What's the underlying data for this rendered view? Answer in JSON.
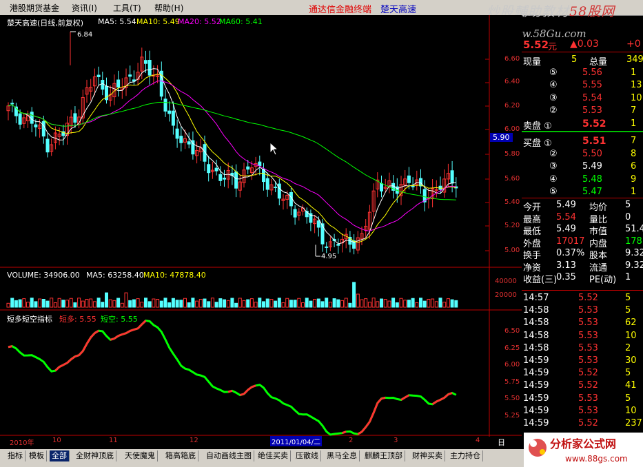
{
  "menu": {
    "items": [
      "港股期货基金",
      "资讯(I)",
      "工具(T)",
      "帮助(H)"
    ],
    "title_a": "通达信金融终端",
    "title_b": "楚天高速"
  },
  "watermarks": {
    "top_text_a": "炒股輔助教材",
    "top_text_b": "58股网",
    "top_url": "www.58Gu.com",
    "bottom_text": "分析家公式网",
    "bottom_url": "www.88gs.com"
  },
  "main_chart": {
    "header": "楚天高速(日线,前复权)",
    "ma5": "MA5: 5.54",
    "ma10": "MA10: 5.49",
    "ma20": "MA20: 5.52",
    "ma60": "MA60: 5.41",
    "high_label": "6.84",
    "low_label": "4.95",
    "y_ticks": [
      "6.60",
      "6.40",
      "6.20",
      "6.00",
      "5.80",
      "5.60",
      "5.40",
      "5.20",
      "5.00"
    ],
    "cursor_price": "5.90"
  },
  "volume_chart": {
    "header": "VOLUME: 34906.00",
    "ma5": "MA5: 63258.40",
    "ma10": "MA10: 47878.40",
    "y_ticks": [
      "40000",
      "20000"
    ]
  },
  "indicator": {
    "name": "短多短空指标",
    "long": "短多: 5.55",
    "short": "短空: 5.55",
    "y_ticks": [
      "6.50",
      "6.25",
      "6.00",
      "5.75",
      "5.50",
      "5.25"
    ]
  },
  "x_axis": {
    "labels": [
      "2010年",
      "10",
      "11",
      "12",
      "2011/01/04/二",
      "2",
      "3",
      "4"
    ],
    "day_label": "日"
  },
  "quote": {
    "price": "5.52",
    "unit": "元",
    "change": "▲0.03",
    "change_pct": "+0",
    "rows": [
      {
        "a": "现量",
        "b": "5",
        "c": "总量",
        "d": "349"
      },
      {
        "a": "⑤",
        "b": "5.56",
        "d": "1"
      },
      {
        "a": "④",
        "b": "5.55",
        "d": "13"
      },
      {
        "a": "③",
        "b": "5.54",
        "d": "10"
      },
      {
        "a": "②",
        "b": "5.53",
        "d": "7"
      },
      {
        "a": "卖盘 ①",
        "b": "5.52",
        "d": "1"
      },
      {
        "a": "买盘 ①",
        "b": "5.51",
        "d": "7"
      },
      {
        "a": "②",
        "b": "5.50",
        "d": "8"
      },
      {
        "a": "③",
        "b": "5.49",
        "d": "6"
      },
      {
        "a": "④",
        "b": "5.48",
        "d": "9"
      },
      {
        "a": "⑤",
        "b": "5.47",
        "d": "1"
      }
    ],
    "stats": [
      {
        "a": "今开",
        "b": "5.49",
        "c": "均价",
        "d": "5"
      },
      {
        "a": "最高",
        "b": "5.54",
        "c": "量比",
        "d": "0"
      },
      {
        "a": "最低",
        "b": "5.49",
        "c": "市值",
        "d": "51.4"
      },
      {
        "a": "外盘",
        "b": "17017",
        "c": "内盘",
        "d": "178"
      },
      {
        "a": "换手",
        "b": "0.37%",
        "c": "股本",
        "d": "9.32"
      },
      {
        "a": "净资",
        "b": "3.13",
        "c": "流通",
        "d": "9.32"
      },
      {
        "a": "收益(三)",
        "b": "0.35",
        "c": "PE(动)",
        "d": "1"
      }
    ],
    "ticks": [
      {
        "t": "14:57",
        "p": "5.52",
        "v": "5"
      },
      {
        "t": "14:58",
        "p": "5.53",
        "v": "5"
      },
      {
        "t": "14:58",
        "p": "5.53",
        "v": "62"
      },
      {
        "t": "14:58",
        "p": "5.53",
        "v": "10"
      },
      {
        "t": "14:58",
        "p": "5.53",
        "v": "2"
      },
      {
        "t": "14:59",
        "p": "5.53",
        "v": "30"
      },
      {
        "t": "14:59",
        "p": "5.52",
        "v": "5"
      },
      {
        "t": "14:59",
        "p": "5.52",
        "v": "41"
      },
      {
        "t": "14:59",
        "p": "5.53",
        "v": "5"
      },
      {
        "t": "14:59",
        "p": "5.53",
        "v": "10"
      },
      {
        "t": "14:59",
        "p": "5.52",
        "v": "237"
      }
    ]
  },
  "tabs": [
    "指标",
    "模板",
    "全部",
    "全财神顶底",
    "天使魔鬼",
    "箱高箱底",
    "自动画线主图",
    "绝佳买卖",
    "压散线",
    "黑马全息",
    "麒麟王顶部",
    "财神买卖",
    "主力持仓"
  ],
  "active_tab": "全部",
  "colors": {
    "up": "#ff3232",
    "down": "#54ffff",
    "ma5": "#ffffff",
    "ma10": "#ffff00",
    "ma20": "#ff00ff",
    "ma60": "#00ff00",
    "axis": "#c00000"
  }
}
